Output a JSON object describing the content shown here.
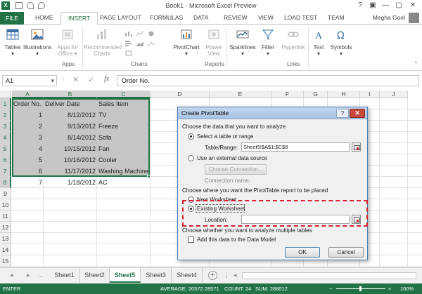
{
  "window": {
    "title": "Book1 - Microsoft Excel Preview",
    "controls": {
      "help": "?",
      "ribbon_display": "▣",
      "minimize": "—",
      "restore": "▢",
      "close": "✕"
    }
  },
  "ribbon_tabs": {
    "file": "FILE",
    "home": "HOME",
    "insert": "INSERT",
    "page_layout": "PAGE LAYOUT",
    "formulas": "FORMULAS",
    "data": "DATA",
    "review": "REVIEW",
    "view": "VIEW",
    "load_test": "LOAD TEST",
    "team": "TEAM",
    "user": "Megha Goel"
  },
  "ribbon": {
    "tables": {
      "label": "Tables",
      "arrow": "▾"
    },
    "illustrations": {
      "label": "Illustrations",
      "arrow": "▾"
    },
    "apps_for_office": {
      "line1": "Apps for",
      "line2": "Office ▾"
    },
    "recommended_charts": {
      "line1": "Recommended",
      "line2": "Charts"
    },
    "pivotchart": {
      "label": "PivotChart",
      "arrow": "▾"
    },
    "power_view": {
      "line1": "Power",
      "line2": "View"
    },
    "sparklines": {
      "label": "Sparklines",
      "arrow": "▾"
    },
    "filter": {
      "label": "Filter",
      "arrow": "▾"
    },
    "hyperlink": {
      "label": "Hyperlink"
    },
    "text": {
      "label": "Text",
      "arrow": "▾"
    },
    "symbols": {
      "label": "Symbols",
      "arrow": "▾"
    },
    "groups": {
      "apps": "Apps",
      "charts": "Charts",
      "reports": "Reports",
      "links": "Links"
    },
    "collapse": "⌃"
  },
  "formula_bar": {
    "name_box": "A1",
    "name_box_arrow": "▾",
    "dots": "⋮",
    "cancel": "✕",
    "enter": "✓",
    "fx": "fx",
    "content": "Order No."
  },
  "grid": {
    "columns": [
      "A",
      "B",
      "C",
      "D",
      "E",
      "F",
      "G",
      "H",
      "I",
      "J"
    ],
    "rows": [
      "1",
      "2",
      "3",
      "4",
      "5",
      "6",
      "7",
      "8",
      "9",
      "10",
      "11",
      "12",
      "13",
      "14",
      "15"
    ],
    "headers": [
      "Order No.",
      "Deliver Date",
      "Sales Item"
    ],
    "data": [
      [
        "1",
        "8/12/2012",
        "TV"
      ],
      [
        "2",
        "9/13/2012",
        "Freeze"
      ],
      [
        "3",
        "8/14/2012",
        "Sofa"
      ],
      [
        "4",
        "10/15/2012",
        "Fan"
      ],
      [
        "5",
        "10/16/2012",
        "Cooler"
      ],
      [
        "6",
        "11/17/2012",
        "Washing Machine"
      ],
      [
        "7",
        "1/18/2012",
        "AC"
      ]
    ]
  },
  "dialog": {
    "title": "Create PivotTable",
    "help": "?",
    "close": "✕",
    "section1": "Choose the data that you want to analyze",
    "opt_table": "Select a table or range",
    "table_range_label": "Table/Range:",
    "table_range_value": "Sheet5!$A$1:$C$8",
    "opt_external": "Use an external data source",
    "choose_connection": "Choose Connection...",
    "connection_name": "Connection name:",
    "section2": "Choose where you want the PivotTable report to be placed",
    "opt_new_ws": "New Worksheet",
    "opt_existing_ws": "Existing Worksheet",
    "location_label": "Location:",
    "location_value": "",
    "section3": "Choose whether you want to analyze multiple tables",
    "add_data_model": "Add this data to the Data Model",
    "ok": "OK",
    "cancel": "Cancel"
  },
  "sheets": {
    "nav_prev": "◂",
    "nav_next": "▸",
    "more": "...",
    "tabs": [
      "Sheet1",
      "Sheet2",
      "Sheet5",
      "Sheet3",
      "Sheet4"
    ],
    "active": "Sheet5",
    "add": "+",
    "menu": "⋮",
    "scroll_left": "◂"
  },
  "status": {
    "mode": "ENTER",
    "average": "AVERAGE: 20572.28571",
    "count": "COUNT: 24",
    "sum": "SUM: 288012",
    "zoom": "100%",
    "zoom_minus": "−",
    "zoom_plus": "+"
  },
  "colors": {
    "excel_green": "#217346",
    "selection_fill": "#c6c6c6",
    "highlight_dashed": "#d62231",
    "dialog_title": "#a8c3e4"
  }
}
